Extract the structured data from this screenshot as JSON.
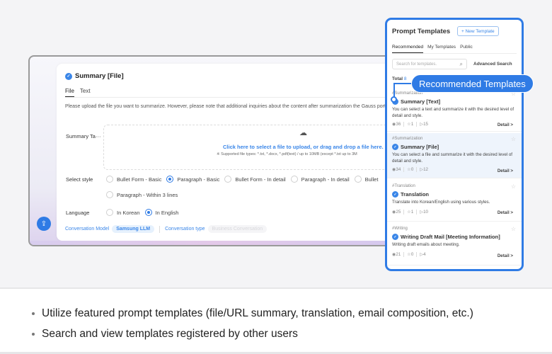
{
  "form": {
    "title": "Summary [File]",
    "tabs": [
      {
        "label": "File",
        "active": true
      },
      {
        "label": "Text",
        "active": false
      }
    ],
    "description": "Please upload the file you want to summarize. However, please note that additional inquiries about the content after summarization the Gauss portal.",
    "summary_target_label": "Summary Ta···",
    "dropzone": {
      "link_text": "Click here to select a file to upload, or drag and drop a file here.",
      "note": "※ Supported file types: *.txt, *.docx, *.pdf(text) / up to 10MB (except *.txt up to 3M"
    },
    "style_label": "Select style",
    "style_options": [
      {
        "label": "Bullet Form - Basic",
        "selected": false
      },
      {
        "label": "Paragraph - Basic",
        "selected": true
      },
      {
        "label": "Bullet Form - In detail",
        "selected": false
      },
      {
        "label": "Paragraph - In detail",
        "selected": false
      },
      {
        "label": "Bullet",
        "selected": false
      },
      {
        "label": "Paragraph - Within 3 lines",
        "selected": false
      }
    ],
    "language_label": "Language",
    "language_options": [
      {
        "label": "In Korean",
        "selected": false
      },
      {
        "label": "In English",
        "selected": true
      }
    ],
    "model_label": "Conversation Model",
    "model_value": "Samsung LLM",
    "type_label": "Conversation type",
    "type_value": "Business Conversation"
  },
  "panel": {
    "title": "Prompt Templates",
    "new_button": "+ New Template",
    "tabs": [
      {
        "label": "Recommended",
        "active": true
      },
      {
        "label": "My Templates",
        "active": false
      },
      {
        "label": "Public",
        "active": false
      }
    ],
    "search_placeholder": "Search for templates.",
    "advanced_search": "Advanced Search",
    "total_label": "Total",
    "total_count": "8",
    "detail_label": "Detail >",
    "items": [
      {
        "tag": "#Summarization",
        "title": "Summary [Text]",
        "desc": "You can select a text and summarize it with the desired level of detail and style.",
        "views": "36",
        "stars": "1",
        "runs": "15",
        "highlighted": false
      },
      {
        "tag": "#Summarization",
        "title": "Summary [File]",
        "desc": "You can select a file and summarize it with the desired level of detail and style.",
        "views": "34",
        "stars": "0",
        "runs": "12",
        "highlighted": true
      },
      {
        "tag": "#Translation",
        "title": "Translation",
        "desc": "Translate into Korean/English using various styles.",
        "views": "25",
        "stars": "1",
        "runs": "10",
        "highlighted": false
      },
      {
        "tag": "#Writing",
        "title": "Writing Draft Mail [Meeting Information]",
        "desc": "Writing draft emails about meeting.",
        "views": "21",
        "stars": "0",
        "runs": "4",
        "highlighted": false
      }
    ]
  },
  "callout": "Recommended Templates",
  "bullets": [
    "Utilize featured prompt templates (file/URL summary, translation, email composition, etc.)",
    "Search and view templates registered by other users"
  ],
  "colors": {
    "accent": "#2f7be5",
    "link": "#3a86e8"
  }
}
